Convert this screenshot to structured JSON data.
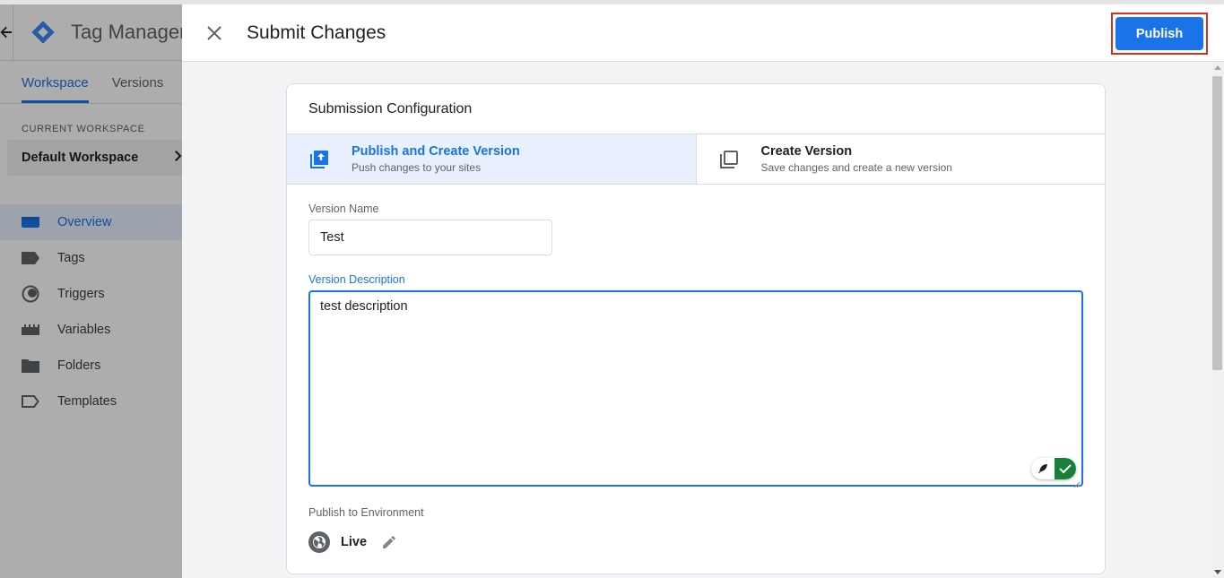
{
  "background_app": {
    "title": "Tag Manager",
    "tabs": [
      {
        "label": "Workspace"
      },
      {
        "label": "Versions"
      }
    ],
    "workspace_label": "CURRENT WORKSPACE",
    "workspace_name": "Default Workspace",
    "nav": [
      {
        "label": "Overview",
        "icon": "overview-icon"
      },
      {
        "label": "Tags",
        "icon": "tag-icon"
      },
      {
        "label": "Triggers",
        "icon": "trigger-icon"
      },
      {
        "label": "Variables",
        "icon": "variables-icon"
      },
      {
        "label": "Folders",
        "icon": "folder-icon"
      },
      {
        "label": "Templates",
        "icon": "template-icon"
      }
    ]
  },
  "dialog": {
    "title": "Submit Changes",
    "publish_label": "Publish",
    "card_title": "Submission Configuration",
    "options": [
      {
        "name": "Publish and Create Version",
        "desc": "Push changes to your sites",
        "selected": true
      },
      {
        "name": "Create Version",
        "desc": "Save changes and create a new version",
        "selected": false
      }
    ],
    "version_name_label": "Version Name",
    "version_name_value": "Test",
    "version_desc_label": "Version Description",
    "version_desc_value": "test description",
    "env_label": "Publish to Environment",
    "env_name": "Live"
  },
  "colors": {
    "accent": "#1a73e8",
    "highlight_border": "#d93025",
    "widget_green": "#188038"
  }
}
